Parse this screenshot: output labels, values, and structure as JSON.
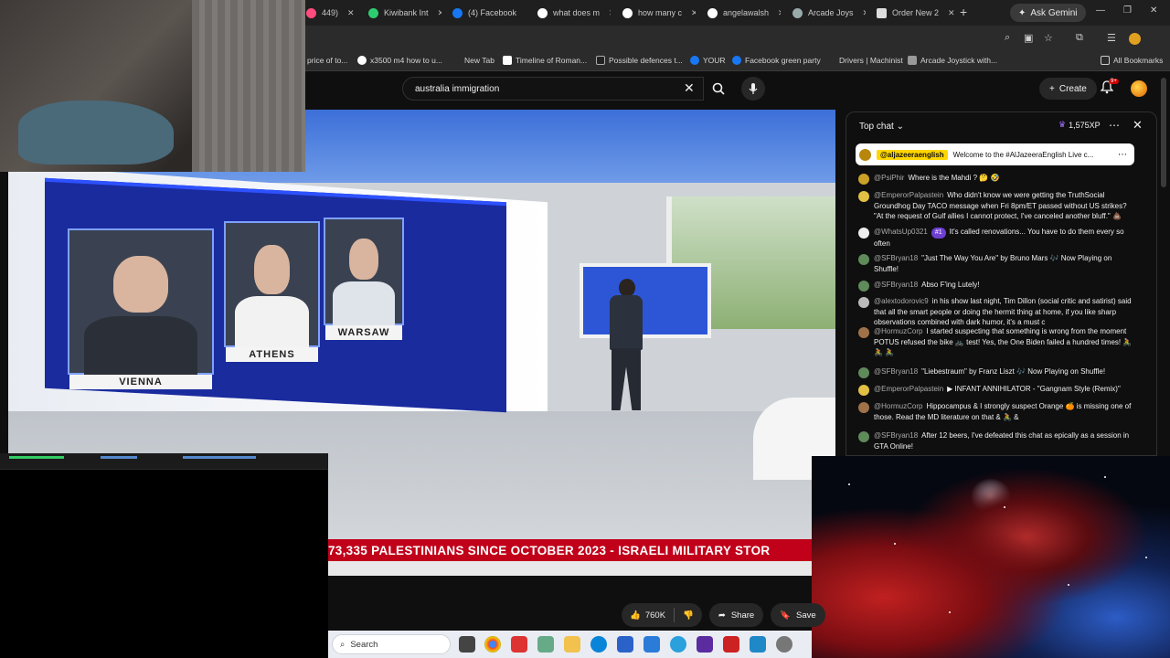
{
  "browser": {
    "tabs": [
      {
        "label": "449)",
        "color": "#ff4b7d"
      },
      {
        "label": "Kiwibank Int",
        "color": "#2ecc71"
      },
      {
        "label": "(4) Facebook",
        "color": "#1877f2"
      },
      {
        "label": "what does m",
        "color": "#ffffff"
      },
      {
        "label": "how many c",
        "color": "#ffffff"
      },
      {
        "label": "angelawalsh",
        "color": "#ffffff"
      },
      {
        "label": "Arcade Joys",
        "color": "#ffffff"
      },
      {
        "label": "Order New 2",
        "color": "#ffffff"
      }
    ],
    "new_tab": "+",
    "gemini_label": "Ask Gemini",
    "bookmarks": [
      "price of to...",
      "x3500 m4 how to u...",
      "New Tab",
      "Timeline of Roman...",
      "Possible defences t...",
      "YOUR",
      "Facebook green party",
      "Drivers | Machinist",
      "Arcade Joystick with..."
    ],
    "all_bookmarks": "All Bookmarks"
  },
  "youtube": {
    "search_value": "australia immigration",
    "create_label": "Create",
    "bell_badge": "9+"
  },
  "video": {
    "guests": [
      "VIENNA",
      "ATHENS",
      "WARSAW"
    ],
    "ticker": "73,335 PALESTINIANS SINCE OCTOBER 2023   -   ISRAELI MILITARY STOR"
  },
  "actions": {
    "likes": "760K",
    "share": "Share",
    "save": "Save"
  },
  "taskbar": {
    "search": "Search"
  },
  "chat": {
    "mode": "Top chat",
    "xp": "1,575XP",
    "pinned_author": "@aljazeeraenglish",
    "pinned_text": "Welcome to the #AlJazeeraEnglish Live c...",
    "messages": [
      {
        "author": "@PsiPhir",
        "text": "Where is the Mahdi ? 🤔 🤣",
        "color": "#c9a227"
      },
      {
        "author": "@EmperorPalpastein",
        "text": "Who didn't know we were getting the TruthSocial Groundhog Day TACO message when Fri 8pm/ET passed without US strikes? \"At the request of Gulf allies I cannot protect, I've canceled another bluff.\" 💩",
        "color": "#e2c044"
      },
      {
        "author": "@WhatsUp0321",
        "badge": "#1",
        "text": "It's called renovations... You have to do them every so often",
        "color": "#eeeeee"
      },
      {
        "author": "@SFBryan18",
        "text": "\"Just The Way You Are\" by Bruno Mars 🎶 Now Playing on Shuffle!",
        "color": "#5f8a5a"
      },
      {
        "author": "@SFBryan18",
        "text": "Abso F'ing Lutely!",
        "color": "#5f8a5a"
      },
      {
        "author": "@alextodorovic9",
        "text": "in his show last night, Tim Dillon (social critic and satirist) said that all the smart people or doing the hermit thing at home, if you like sharp observations combined with dark humor, it's a must c",
        "color": "#bbbbbb"
      },
      {
        "author": "@HormuzCorp",
        "text": "I started suspecting that something is wrong from the moment POTUS refused the bike 🚲 test! Yes, the One Biden failed a hundred times! 🚴 🚴 🚴",
        "color": "#a0724a"
      },
      {
        "author": "@SFBryan18",
        "text": "\"Liebestraum\" by Franz Liszt 🎶 Now Playing on Shuffle!",
        "color": "#5f8a5a"
      },
      {
        "author": "@EmperorPalpastein",
        "text": "▶ INFANT ANNIHILATOR - \"Gangnam Style (Remix)\"",
        "color": "#e2c044"
      },
      {
        "author": "@HormuzCorp",
        "text": "Hippocampus & I strongly suspect Orange 🍊 is missing one of those. Read the MD literature on that & 🚴 &",
        "color": "#a0724a"
      },
      {
        "author": "@SFBryan18",
        "text": "After 12 beers, I've defeated this chat as epically as a session in GTA Online!",
        "color": "#5f8a5a"
      }
    ]
  }
}
